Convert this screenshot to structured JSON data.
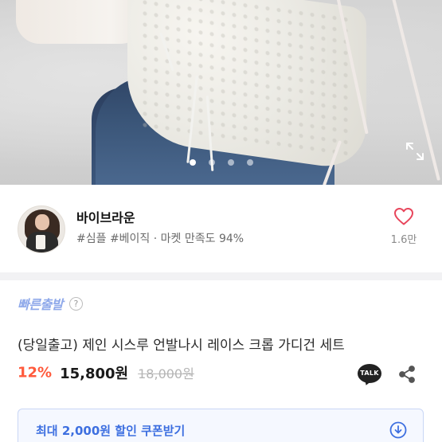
{
  "seller": {
    "name": "바이브라운",
    "tags": "#심플 #베이직 · 마켓 만족도 94%",
    "like_count": "1.6만"
  },
  "product": {
    "fast_shipping_label": "빠른출발",
    "help_symbol": "?",
    "title": "(당일출고) 제인 시스루 언발나시 레이스 크롭 가디건 세트",
    "discount": "12%",
    "price": "15,800원",
    "original_price": "18,000원",
    "talk_label": "TALK"
  },
  "carousel": {
    "total": 4,
    "active_index": 0
  },
  "coupon": {
    "label": "최대 2,000원 할인 쿠폰받기"
  },
  "colors": {
    "accent_blue": "#3d6fe0",
    "discount_red": "#ff5a3c",
    "fast_shipping": "#8fa9ea",
    "like_red": "#e8455b"
  },
  "icons": {
    "expand": "expand-icon",
    "heart": "heart-icon",
    "talk": "kakaotalk-icon",
    "share": "share-icon",
    "coupon_download": "download-icon"
  }
}
